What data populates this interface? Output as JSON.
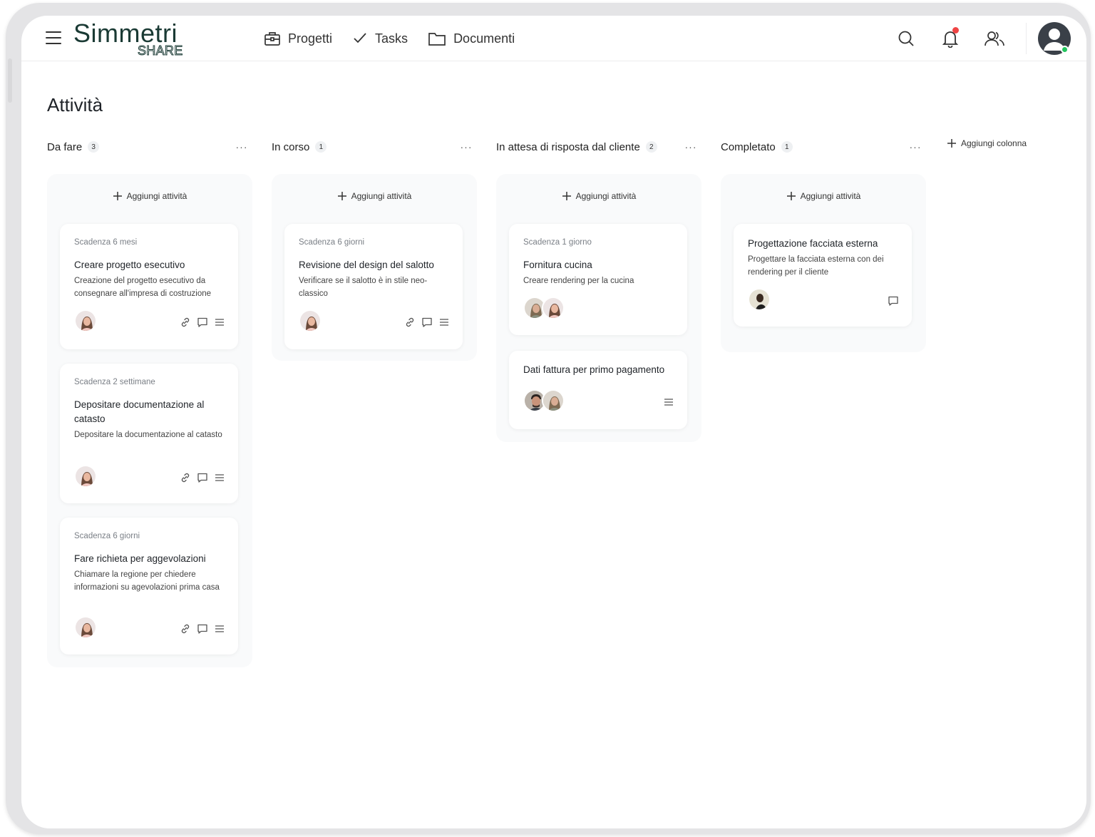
{
  "app": {
    "logo_main": "Simmetri",
    "logo_sub": "SHARE"
  },
  "nav": {
    "items": [
      {
        "label": "Progetti",
        "icon": "briefcase-icon"
      },
      {
        "label": "Tasks",
        "icon": "check-icon"
      },
      {
        "label": "Documenti",
        "icon": "folder-icon"
      }
    ]
  },
  "header_icons": [
    "search-icon",
    "bell-icon",
    "users-icon",
    "user-avatar"
  ],
  "colors": {
    "brand": "#1a3a34",
    "notification": "#ef4444",
    "online": "#22c55e",
    "column_bg": "#f9fafb"
  },
  "page": {
    "title": "Attività",
    "add_column_label": "Aggiungi colonna",
    "add_task_label": "Aggiungi attività",
    "more_label": "···"
  },
  "columns": [
    {
      "title": "Da fare",
      "count": "3",
      "cards": [
        {
          "due": "Scadenza 6 mesi",
          "title": "Creare progetto esecutivo",
          "desc": "Creazione del progetto esecutivo da consegnare all'impresa di costruzione"
        },
        {
          "due": "Scadenza 2 settimane",
          "title": "Depositare documentazione al catasto",
          "desc": "Depositare la documentazione al catasto"
        },
        {
          "due": "Scadenza 6 giorni",
          "title": "Fare richieta per aggevolazioni",
          "desc": "Chiamare la regione per chiedere informazioni su agevolazioni prima casa"
        }
      ]
    },
    {
      "title": "In corso",
      "count": "1",
      "cards": [
        {
          "due": "Scadenza 6 giorni",
          "title": "Revisione del design del salotto",
          "desc": "Verificare se il salotto è in stile neo-classico"
        }
      ]
    },
    {
      "title": "In attesa di risposta dal cliente",
      "count": "2",
      "cards": [
        {
          "due": "Scadenza 1 giorno",
          "title": "Fornitura cucina",
          "desc": "Creare rendering per la cucina"
        },
        {
          "title": "Dati fattura per primo pagamento"
        }
      ]
    },
    {
      "title": "Completato",
      "count": "1",
      "cards": [
        {
          "title": "Progettazione facciata esterna",
          "desc": "Progettare la facciata esterna con dei rendering per il cliente"
        }
      ]
    }
  ]
}
